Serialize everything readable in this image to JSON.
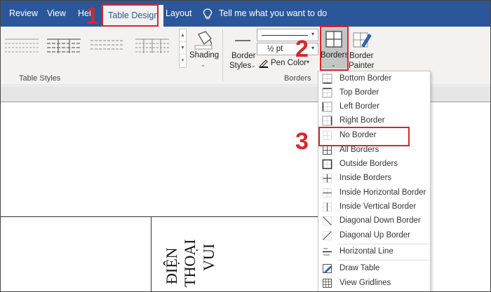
{
  "tabs": [
    {
      "label": "Review"
    },
    {
      "label": "View"
    },
    {
      "label": "Hel"
    },
    {
      "label": "Table Design"
    },
    {
      "label": "Layout"
    }
  ],
  "tell_me": "Tell me what you want to do",
  "ribbon": {
    "table_styles_label": "Table Styles",
    "shading_label": "Shading",
    "border_styles_label_1": "Border",
    "border_styles_label_2": "Styles",
    "pen_weight": "½ pt",
    "pen_color_label": "Pen Color",
    "borders_group_label": "Borders",
    "borders_button_label": "Borders",
    "border_painter_label_1": "Border",
    "border_painter_label_2": "Painter"
  },
  "document": {
    "vertical_lines": [
      "ĐIỆN",
      "THOẠI",
      "VUI"
    ]
  },
  "borders_menu": {
    "items": [
      {
        "label": "Bottom Border",
        "icon": "bottom-border-icon",
        "highlighted_icon": true
      },
      {
        "label": "Top Border",
        "icon": "top-border-icon",
        "highlighted_icon": true
      },
      {
        "label": "Left Border",
        "icon": "left-border-icon",
        "highlighted_icon": true
      },
      {
        "label": "Right Border",
        "icon": "right-border-icon",
        "highlighted_icon": true
      },
      {
        "label": "No Border",
        "icon": "no-border-icon",
        "highlighted_icon": false
      },
      {
        "label": "All Borders",
        "icon": "all-borders-icon",
        "highlighted_icon": false
      },
      {
        "label": "Outside Borders",
        "icon": "outside-borders-icon",
        "highlighted_icon": true
      },
      {
        "label": "Inside Borders",
        "icon": "inside-borders-icon",
        "highlighted_icon": false
      },
      {
        "label": "Inside Horizontal Border",
        "icon": "inside-horizontal-border-icon",
        "highlighted_icon": false
      },
      {
        "label": "Inside Vertical Border",
        "icon": "inside-vertical-border-icon",
        "highlighted_icon": false
      },
      {
        "label": "Diagonal Down Border",
        "icon": "diagonal-down-border-icon",
        "highlighted_icon": false
      },
      {
        "label": "Diagonal Up Border",
        "icon": "diagonal-up-border-icon",
        "highlighted_icon": false
      },
      {
        "label": "Horizontal Line",
        "icon": "horizontal-line-icon",
        "highlighted_icon": false
      },
      {
        "label": "Draw Table",
        "icon": "draw-table-icon",
        "highlighted_icon": false
      },
      {
        "label": "View Gridlines",
        "icon": "view-gridlines-icon",
        "highlighted_icon": false
      }
    ]
  },
  "annotations": {
    "step1": "1",
    "step2": "2",
    "step3": "3"
  },
  "colors": {
    "ribbon_blue": "#2b579a",
    "annotation_red": "#d9262c",
    "ribbon_bg": "#f3f2f1"
  }
}
